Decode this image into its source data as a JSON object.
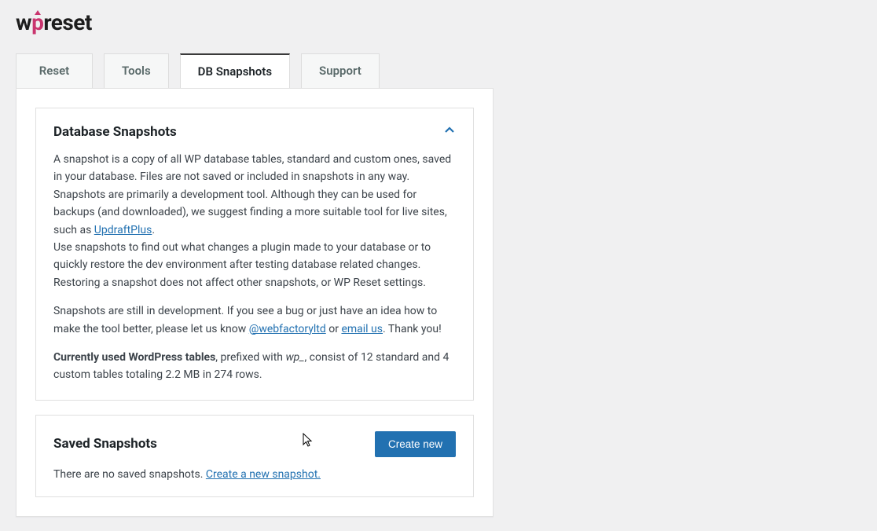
{
  "logo": {
    "part1": "w",
    "accent": "p",
    "part2": "reset"
  },
  "tabs": [
    {
      "label": "Reset",
      "active": false
    },
    {
      "label": "Tools",
      "active": false
    },
    {
      "label": "DB Snapshots",
      "active": true
    },
    {
      "label": "Support",
      "active": false
    }
  ],
  "dbpanel": {
    "title": "Database Snapshots",
    "p1": "A snapshot is a copy of all WP database tables, standard and custom ones, saved in your database. Files are not saved or included in snapshots in any way.",
    "p2a": "Snapshots are primarily a development tool. Although they can be used for backups (and downloaded), we suggest finding a more suitable tool for live sites, such as ",
    "p2_link": "UpdraftPlus",
    "p2b": ".",
    "p3": "Use snapshots to find out what changes a plugin made to your database or to quickly restore the dev environment after testing database related changes.",
    "p4": "Restoring a snapshot does not affect other snapshots, or WP Reset settings.",
    "p5a": "Snapshots are still in development. If you see a bug or just have an idea how to make the tool better, please let us know ",
    "p5_link1": "@webfactoryltd",
    "p5b": " or ",
    "p5_link2": "email us",
    "p5c": ". Thank you!",
    "p6_strong": "Currently used WordPress tables",
    "p6a": ", prefixed with ",
    "p6_em": "wp_",
    "p6b": ", consist of 12 standard and 4 custom tables totaling 2.2 MB in 274 rows."
  },
  "saved": {
    "title": "Saved Snapshots",
    "button": "Create new",
    "empty_prefix": "There are no saved snapshots. ",
    "empty_link": "Create a new snapshot."
  }
}
